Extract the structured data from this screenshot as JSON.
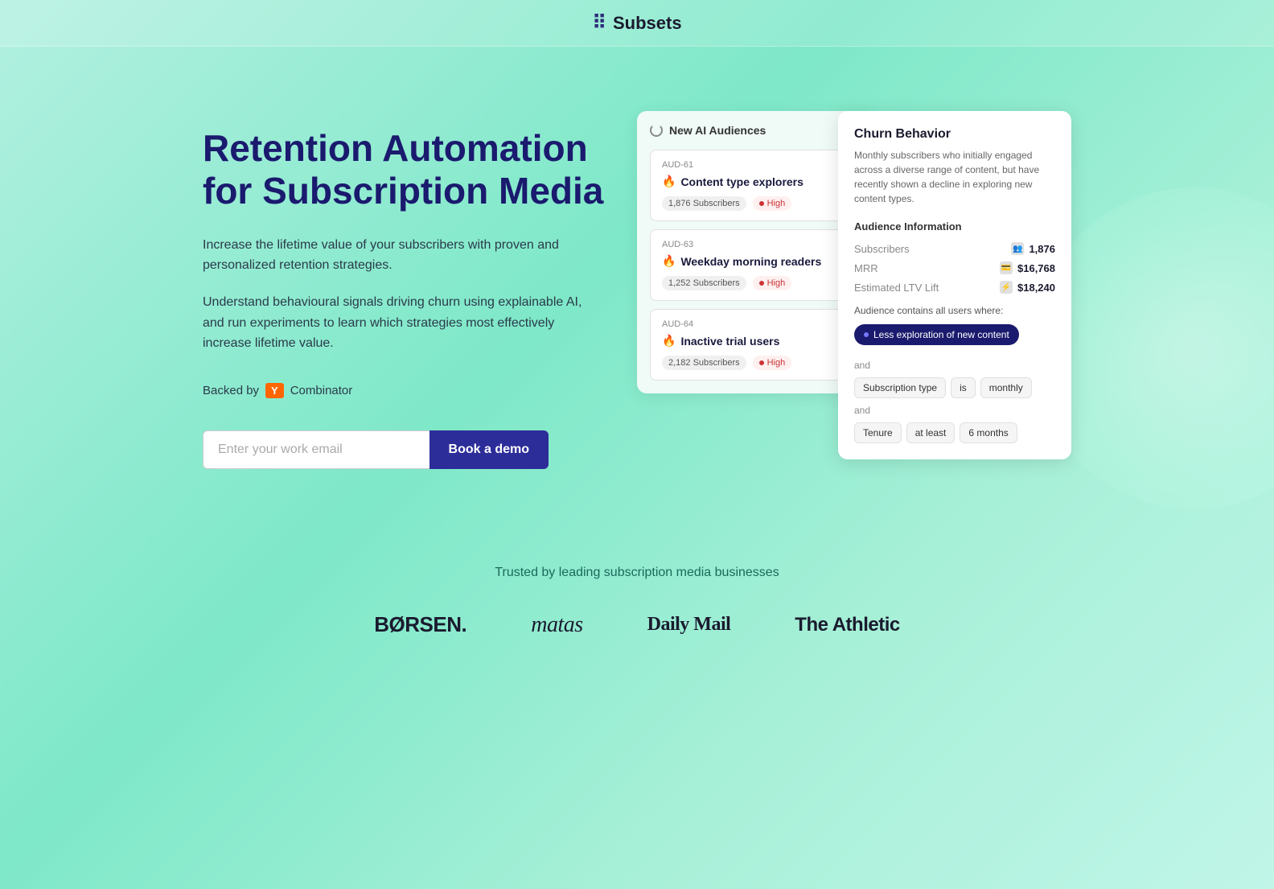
{
  "header": {
    "logo_text": "Subsets",
    "logo_symbol": "⠿"
  },
  "hero": {
    "title": "Retention Automation for Subscription Media",
    "desc1": "Increase the lifetime value of your subscribers with proven and personalized retention strategies.",
    "desc2": "Understand behavioural signals driving churn using explainable AI, and run experiments to learn which strategies most effectively increase lifetime value.",
    "backed_by_label": "Backed by",
    "yc_label": "Y",
    "combinator_label": "Combinator",
    "email_placeholder": "Enter your work email",
    "demo_button": "Book a demo"
  },
  "ai_panel": {
    "header": "New AI Audiences",
    "cards": [
      {
        "id": "AUD-61",
        "name": "Content type explorers",
        "subscribers": "1,876 Subscribers",
        "risk": "High"
      },
      {
        "id": "AUD-63",
        "name": "Weekday morning readers",
        "subscribers": "1,252 Subscribers",
        "risk": "High"
      },
      {
        "id": "AUD-64",
        "name": "Inactive trial users",
        "subscribers": "2,182 Subscribers",
        "risk": "High"
      }
    ]
  },
  "churn_panel": {
    "title": "Churn Behavior",
    "description": "Monthly subscribers who initially engaged across a diverse range of content, but have recently shown a decline in exploring new content types.",
    "audience_info_title": "Audience Information",
    "rows": [
      {
        "label": "Subscribers",
        "value": "1,876",
        "icon": "👥"
      },
      {
        "label": "MRR",
        "value": "$16,768",
        "icon": "💳"
      },
      {
        "label": "Estimated LTV Lift",
        "value": "$18,240",
        "icon": "⚡"
      }
    ],
    "contains_label": "Audience contains all users where:",
    "condition_chip": "Less exploration of new content",
    "and_label_1": "and",
    "and_label_2": "and",
    "condition1": {
      "tags": [
        "Subscription type",
        "is",
        "monthly"
      ]
    },
    "condition2": {
      "tags": [
        "Tenure",
        "at least",
        "6 months"
      ]
    }
  },
  "trusted": {
    "label": "Trusted by leading subscription media businesses",
    "brands": [
      "BØRSEN.",
      "matas",
      "Daily Mail",
      "The Athletic"
    ]
  }
}
